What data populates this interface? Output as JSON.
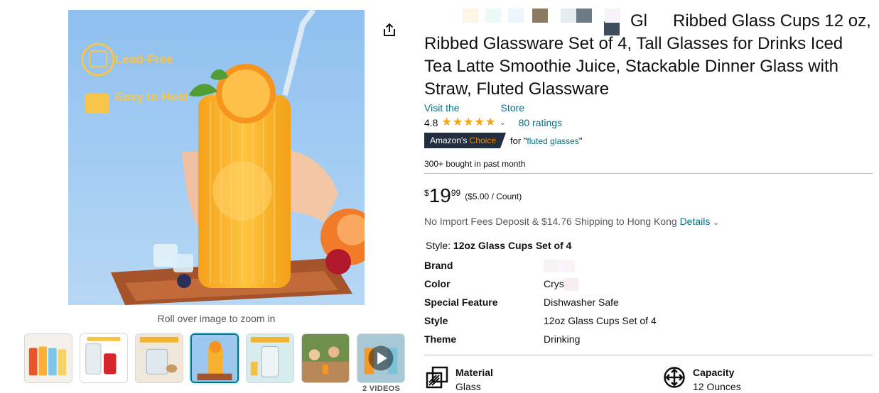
{
  "product": {
    "title_part1": "Gl",
    "title_part2": "Ribbed Glass Cups 12 oz, Ribbed Glassware Set of 4, Tall Glasses for Drinks Iced Tea Latte Smoothie Juice, Stackable Dinner Glass with Straw, Fluted Glassware",
    "store_prefix": "Visit the",
    "store_suffix": "Store",
    "rating": "4.8",
    "rating_stars": 4.8,
    "ratings_count": "80 ratings",
    "badge_prefix": "Amazon's",
    "badge_word": "Choice",
    "badge_for": "for \"",
    "badge_keyword": "fluted glasses",
    "badge_close": "\"",
    "bought": "300+ bought in past month",
    "price_symbol": "$",
    "price_whole": "19",
    "price_fraction": "99",
    "price_unit": "($5.00 / Count)",
    "shipping": "No Import Fees Deposit & $14.76 Shipping to Hong Kong",
    "shipping_link": "Details",
    "style_label": "Style:",
    "style_value": "12oz Glass Cups Set of 4"
  },
  "gallery": {
    "overlay_lead_free": "Lead-Free",
    "overlay_easy_hold": "Easy to Hold",
    "zoom_hint": "Roll over image to zoom in",
    "videos_label": "2 VIDEOS",
    "active_index": 3
  },
  "specs": [
    {
      "key": "Brand",
      "value": ""
    },
    {
      "key": "Color",
      "value": "Crys"
    },
    {
      "key": "Special Feature",
      "value": "Dishwasher Safe"
    },
    {
      "key": "Style",
      "value": "12oz Glass Cups Set of 4"
    },
    {
      "key": "Theme",
      "value": "Drinking"
    }
  ],
  "features": [
    {
      "name": "Material",
      "value": "Glass",
      "icon": "material-icon"
    },
    {
      "name": "Capacity",
      "value": "12 Ounces",
      "icon": "capacity-icon"
    }
  ],
  "colors": {
    "link": "#007185",
    "star": "#f7a210",
    "badge_bg": "#232f3e",
    "badge_accent": "#f08804"
  }
}
